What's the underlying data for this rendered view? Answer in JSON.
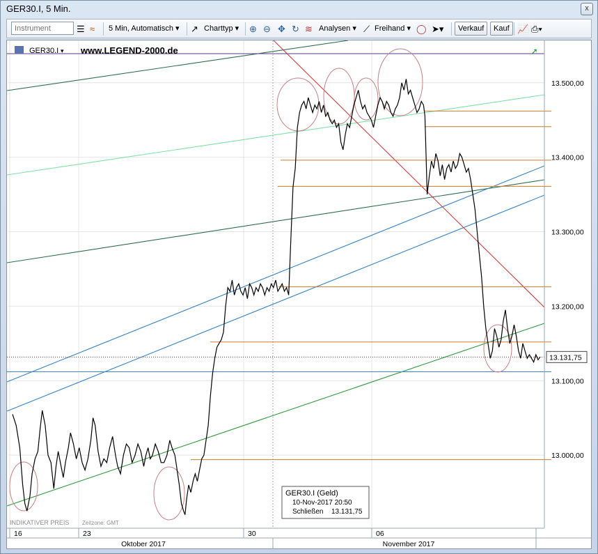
{
  "window": {
    "title": "GER30.I, 5 Min.",
    "close_glyph": "x"
  },
  "toolbar": {
    "instrument_placeholder": "Instrument",
    "interval_label": "5 Min,  Automatisch",
    "charttype_label": "Charttyp",
    "analysen_label": "Analysen",
    "freihand_label": "Freihand",
    "verkauf_label": "Verkauf",
    "kauf_label": "Kauf"
  },
  "chart_header": {
    "symbol": "GER30.I",
    "watermark": "www.LEGEND-2000.de"
  },
  "footer": {
    "indicative": "INDIKATIVER PREIS",
    "timezone": "Zeitzone: GMT"
  },
  "info_box": {
    "title": "GER30.I (Geld)",
    "datetime": "10-Nov-2017 20:50",
    "close_label": "Schließen",
    "close_value": "13.131,75"
  },
  "current_price_label": "13.131,75",
  "colors": {
    "price": "#000000",
    "orange": "#d07a2a",
    "blue": "#3a86c8",
    "red": "#d83a3a",
    "green": "#2f9a3e",
    "darkgreen": "#2e6e4a",
    "mint": "#7ee0a8",
    "circle": "#c88080"
  },
  "chart_data": {
    "type": "line",
    "y_ticks": [
      "13.500,00",
      "13.400,00",
      "13.300,00",
      "13.200,00",
      "13.100,00",
      "13.000,00"
    ],
    "y_tick_values": [
      13500,
      13400,
      13300,
      13200,
      13100,
      13000
    ],
    "ylim": [
      12915,
      13540
    ],
    "x_day_ticks": [
      "16",
      "23",
      "30",
      "06"
    ],
    "x_month_labels": [
      "Oktober 2017",
      "November 2017"
    ],
    "horizontal_levels": [
      13462,
      13441,
      13396,
      13361,
      13226,
      13152,
      12994
    ],
    "support_line": 13112,
    "price_series": [
      [
        0,
        13055
      ],
      [
        5,
        13040
      ],
      [
        10,
        13010
      ],
      [
        14,
        12960
      ],
      [
        17,
        12935
      ],
      [
        20,
        12925
      ],
      [
        24,
        12945
      ],
      [
        27,
        12975
      ],
      [
        31,
        12995
      ],
      [
        35,
        13005
      ],
      [
        38,
        13035
      ],
      [
        41,
        13060
      ],
      [
        45,
        13040
      ],
      [
        49,
        13000
      ],
      [
        53,
        12990
      ],
      [
        57,
        12955
      ],
      [
        60,
        12985
      ],
      [
        63,
        13005
      ],
      [
        66,
        12990
      ],
      [
        70,
        12970
      ],
      [
        73,
        12990
      ],
      [
        77,
        13010
      ],
      [
        80,
        13030
      ],
      [
        84,
        13015
      ],
      [
        88,
        12995
      ],
      [
        92,
        13010
      ],
      [
        96,
        12990
      ],
      [
        100,
        12980
      ],
      [
        104,
        12995
      ],
      [
        108,
        13020
      ],
      [
        111,
        13050
      ],
      [
        114,
        13040
      ],
      [
        118,
        13005
      ],
      [
        122,
        12985
      ],
      [
        126,
        12995
      ],
      [
        130,
        12990
      ],
      [
        134,
        13010
      ],
      [
        138,
        13025
      ],
      [
        142,
        13000
      ],
      [
        145,
        12985
      ],
      [
        149,
        12975
      ],
      [
        153,
        13000
      ],
      [
        157,
        13015
      ],
      [
        161,
        13010
      ],
      [
        165,
        12990
      ],
      [
        169,
        13000
      ],
      [
        173,
        13015
      ],
      [
        177,
        13005
      ],
      [
        181,
        12985
      ],
      [
        184,
        13000
      ],
      [
        187,
        13010
      ],
      [
        190,
        12995
      ],
      [
        193,
        13000
      ],
      [
        197,
        13015
      ],
      [
        201,
        13005
      ],
      [
        205,
        12990
      ],
      [
        209,
        12990
      ],
      [
        213,
        13000
      ],
      [
        217,
        13020
      ],
      [
        220,
        13010
      ],
      [
        224,
        13000
      ],
      [
        227,
        12980
      ],
      [
        230,
        12960
      ],
      [
        233,
        12935
      ],
      [
        236,
        12925
      ],
      [
        238,
        12920
      ],
      [
        240,
        12940
      ],
      [
        243,
        12960
      ],
      [
        246,
        12950
      ],
      [
        249,
        12965
      ],
      [
        252,
        12975
      ],
      [
        255,
        12965
      ],
      [
        258,
        12980
      ],
      [
        261,
        12995
      ],
      [
        264,
        13000
      ],
      [
        267,
        13020
      ],
      [
        270,
        13040
      ],
      [
        273,
        13080
      ],
      [
        276,
        13110
      ],
      [
        279,
        13130
      ],
      [
        282,
        13145
      ],
      [
        285,
        13150
      ],
      [
        288,
        13155
      ],
      [
        291,
        13165
      ],
      [
        294,
        13200
      ],
      [
        297,
        13225
      ],
      [
        300,
        13220
      ],
      [
        303,
        13235
      ],
      [
        306,
        13215
      ],
      [
        309,
        13225
      ],
      [
        312,
        13230
      ],
      [
        315,
        13220
      ],
      [
        318,
        13215
      ],
      [
        321,
        13225
      ],
      [
        324,
        13210
      ],
      [
        327,
        13230
      ],
      [
        330,
        13225
      ],
      [
        333,
        13215
      ],
      [
        336,
        13225
      ],
      [
        339,
        13220
      ],
      [
        342,
        13230
      ],
      [
        345,
        13225
      ],
      [
        348,
        13215
      ],
      [
        351,
        13225
      ],
      [
        354,
        13220
      ],
      [
        357,
        13230
      ],
      [
        360,
        13225
      ],
      [
        363,
        13235
      ],
      [
        366,
        13220
      ],
      [
        369,
        13225
      ],
      [
        372,
        13230
      ],
      [
        375,
        13220
      ],
      [
        378,
        13225
      ],
      [
        381,
        13215
      ],
      [
        384,
        13290
      ],
      [
        387,
        13360
      ],
      [
        390,
        13385
      ],
      [
        393,
        13440
      ],
      [
        396,
        13460
      ],
      [
        399,
        13470
      ],
      [
        402,
        13475
      ],
      [
        405,
        13465
      ],
      [
        408,
        13480
      ],
      [
        411,
        13470
      ],
      [
        414,
        13460
      ],
      [
        417,
        13470
      ],
      [
        420,
        13465
      ],
      [
        423,
        13475
      ],
      [
        426,
        13460
      ],
      [
        429,
        13470
      ],
      [
        432,
        13455
      ],
      [
        435,
        13460
      ],
      [
        438,
        13450
      ],
      [
        441,
        13445
      ],
      [
        444,
        13450
      ],
      [
        447,
        13440
      ],
      [
        450,
        13445
      ],
      [
        453,
        13420
      ],
      [
        456,
        13410
      ],
      [
        459,
        13430
      ],
      [
        462,
        13445
      ],
      [
        465,
        13440
      ],
      [
        468,
        13455
      ],
      [
        471,
        13470
      ],
      [
        474,
        13480
      ],
      [
        477,
        13490
      ],
      [
        480,
        13475
      ],
      [
        483,
        13465
      ],
      [
        486,
        13470
      ],
      [
        489,
        13460
      ],
      [
        492,
        13455
      ],
      [
        495,
        13450
      ],
      [
        498,
        13440
      ],
      [
        501,
        13455
      ],
      [
        504,
        13470
      ],
      [
        507,
        13480
      ],
      [
        510,
        13475
      ],
      [
        513,
        13465
      ],
      [
        516,
        13475
      ],
      [
        519,
        13470
      ],
      [
        522,
        13460
      ],
      [
        525,
        13455
      ],
      [
        528,
        13465
      ],
      [
        531,
        13470
      ],
      [
        534,
        13480
      ],
      [
        537,
        13500
      ],
      [
        540,
        13490
      ],
      [
        543,
        13505
      ],
      [
        546,
        13485
      ],
      [
        549,
        13490
      ],
      [
        552,
        13480
      ],
      [
        555,
        13470
      ],
      [
        558,
        13460
      ],
      [
        561,
        13465
      ],
      [
        564,
        13475
      ],
      [
        567,
        13470
      ],
      [
        569,
        13455
      ],
      [
        570,
        13420
      ],
      [
        572,
        13350
      ],
      [
        575,
        13375
      ],
      [
        578,
        13395
      ],
      [
        581,
        13385
      ],
      [
        584,
        13405
      ],
      [
        587,
        13395
      ],
      [
        590,
        13375
      ],
      [
        593,
        13390
      ],
      [
        596,
        13370
      ],
      [
        599,
        13385
      ],
      [
        602,
        13390
      ],
      [
        605,
        13380
      ],
      [
        608,
        13395
      ],
      [
        611,
        13385
      ],
      [
        614,
        13390
      ],
      [
        617,
        13405
      ],
      [
        620,
        13400
      ],
      [
        623,
        13390
      ],
      [
        626,
        13380
      ],
      [
        629,
        13385
      ],
      [
        632,
        13370
      ],
      [
        635,
        13350
      ],
      [
        638,
        13330
      ],
      [
        641,
        13300
      ],
      [
        644,
        13270
      ],
      [
        647,
        13240
      ],
      [
        650,
        13200
      ],
      [
        653,
        13170
      ],
      [
        656,
        13150
      ],
      [
        659,
        13130
      ],
      [
        662,
        13140
      ],
      [
        665,
        13170
      ],
      [
        668,
        13160
      ],
      [
        671,
        13145
      ],
      [
        674,
        13155
      ],
      [
        677,
        13180
      ],
      [
        680,
        13195
      ],
      [
        683,
        13170
      ],
      [
        686,
        13150
      ],
      [
        689,
        13160
      ],
      [
        692,
        13175
      ],
      [
        695,
        13160
      ],
      [
        698,
        13140
      ],
      [
        701,
        13130
      ],
      [
        704,
        13150
      ],
      [
        707,
        13140
      ],
      [
        710,
        13130
      ],
      [
        713,
        13135
      ],
      [
        716,
        13130
      ],
      [
        719,
        13125
      ],
      [
        722,
        13135
      ],
      [
        725,
        13128
      ],
      [
        728,
        13132
      ]
    ]
  }
}
